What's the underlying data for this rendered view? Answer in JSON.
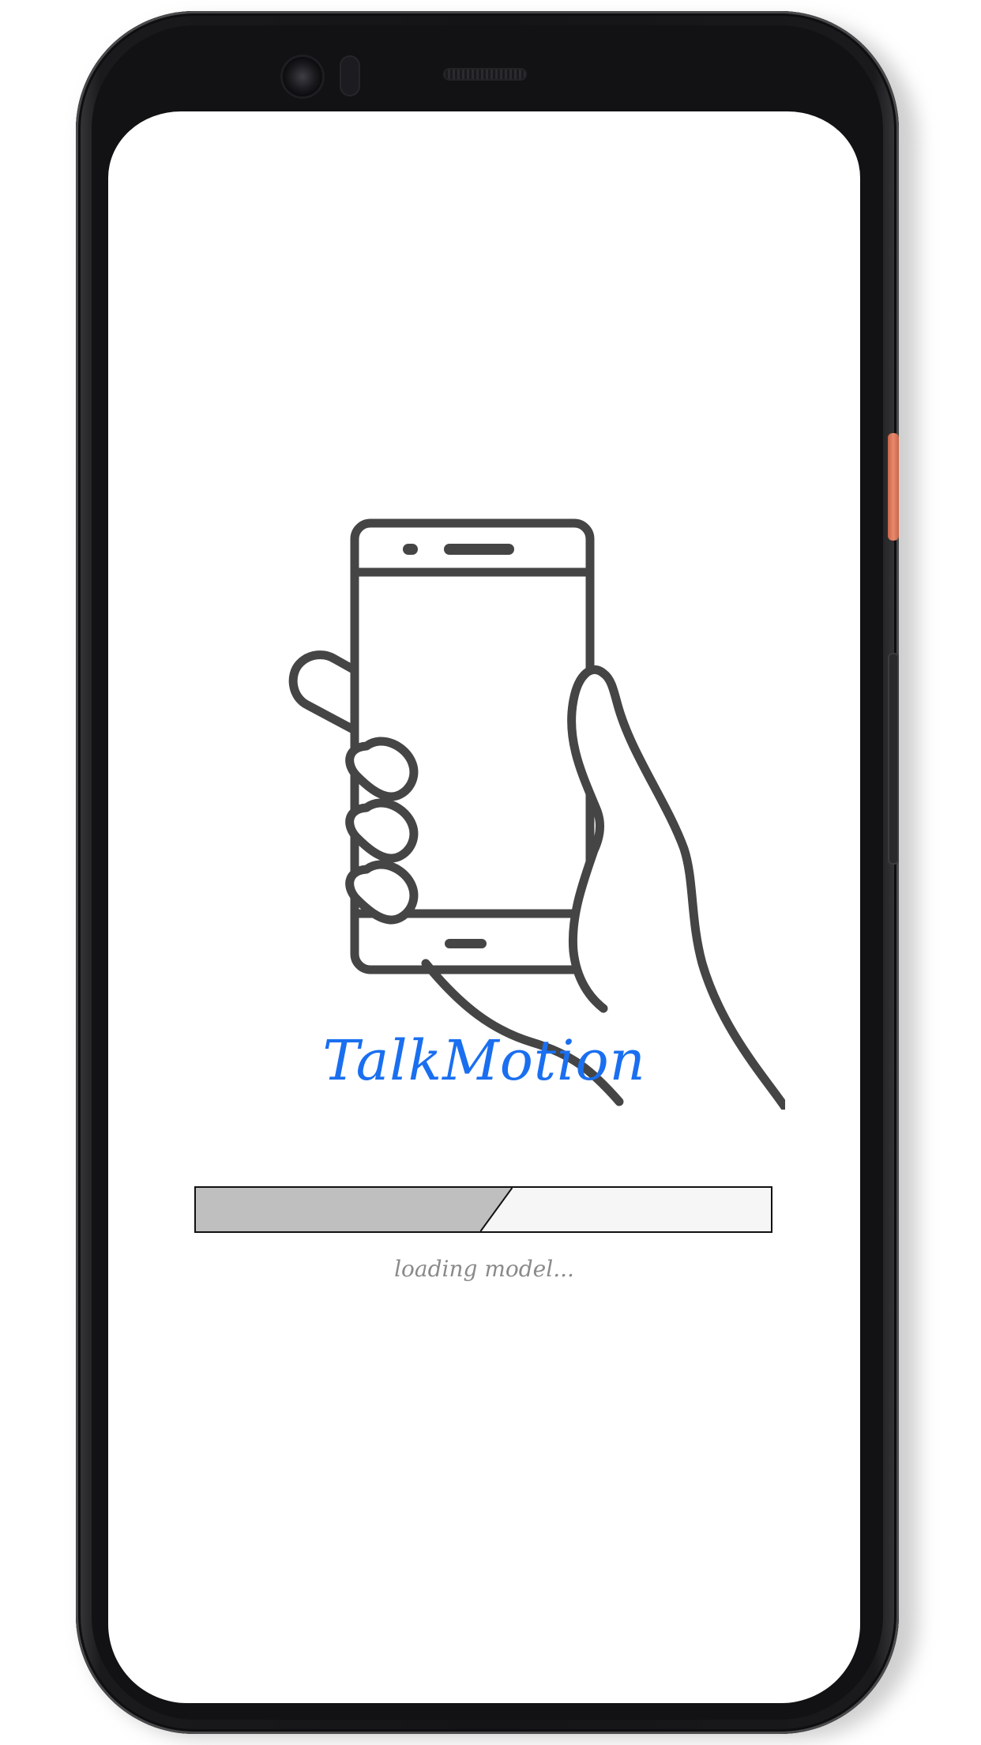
{
  "app": {
    "title": "TalkMotion"
  },
  "loading": {
    "progress": 0.55,
    "status": "loading model..."
  },
  "icons": {
    "illustration": "hand-holding-phone-icon"
  },
  "colors": {
    "title": "#1a6ff0",
    "progress_fill": "#bfbfbf",
    "progress_track": "#f6f6f6",
    "status_text": "#8a8a8a",
    "illustration_stroke": "#454545"
  }
}
